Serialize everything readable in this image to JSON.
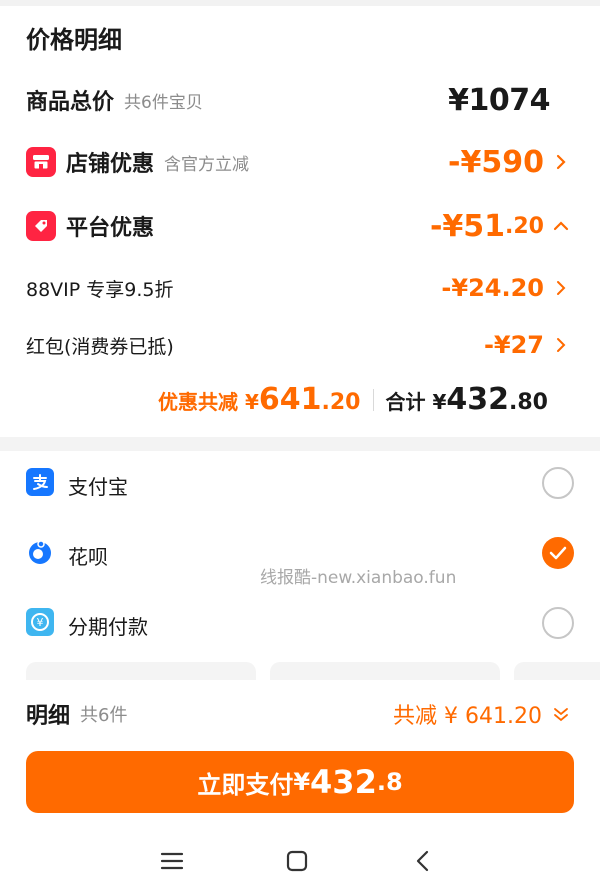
{
  "title": "价格明细",
  "total": {
    "label": "商品总价",
    "sub": "共6件宝贝",
    "value": "¥1074"
  },
  "shop_discount": {
    "label": "店铺优惠",
    "sub": "含官方立减",
    "value_main": "-¥590",
    "value_dec": ""
  },
  "platform_discount": {
    "label": "平台优惠",
    "value_main": "-¥51",
    "value_dec": ".20"
  },
  "vip": {
    "label": "88VIP 专享9.5折",
    "value": "-¥24.20"
  },
  "redpacket": {
    "label": "红包(消费券已抵)",
    "value": "-¥27"
  },
  "summary": {
    "discount_label": "优惠共减 ¥",
    "discount_main": "641",
    "discount_dec": ".20",
    "total_label": "合计 ¥",
    "total_main": "432",
    "total_dec": ".80"
  },
  "payments": [
    {
      "label": "支付宝",
      "icon": "alipay-icon",
      "selected": false
    },
    {
      "label": "花呗",
      "icon": "huabei-icon",
      "selected": true
    },
    {
      "label": "分期付款",
      "icon": "installment-icon",
      "selected": false
    }
  ],
  "watermark": "线报酷-new.xianbao.fun",
  "detail": {
    "label": "明细",
    "sub": "共6件",
    "right": "共减 ¥ 641.20"
  },
  "pay_button": {
    "label": "立即支付",
    "amount_prefix": "¥",
    "amount_main": "432",
    "amount_dec": ".8"
  },
  "colors": {
    "accent": "#ff6a00",
    "badge_red": "#ff2442",
    "alipay_blue": "#1677ff"
  }
}
